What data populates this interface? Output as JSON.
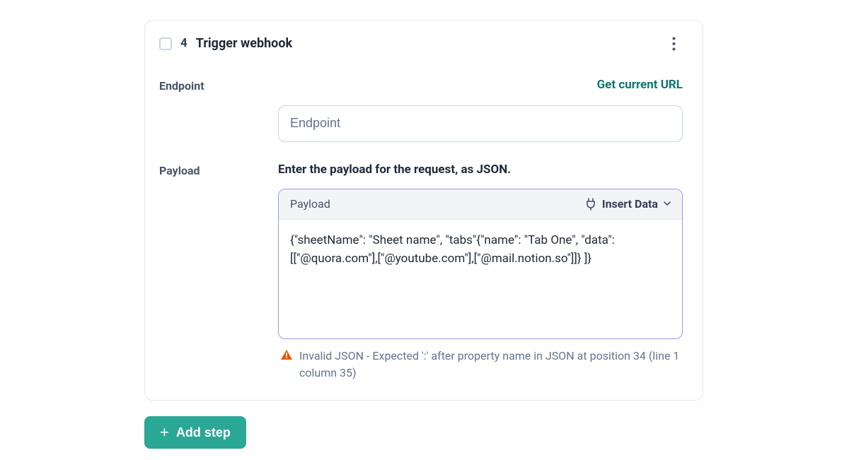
{
  "step": {
    "number": "4",
    "title": "Trigger webhook"
  },
  "endpoint": {
    "label": "Endpoint",
    "link": "Get current URL",
    "placeholder": "Endpoint",
    "value": ""
  },
  "payload": {
    "label": "Payload",
    "helper": "Enter the payload for the request, as JSON.",
    "box_label": "Payload",
    "insert_label": "Insert Data",
    "value": "{\"sheetName\": \"Sheet name\", \"tabs\"{\"name\": \"Tab One\", \"data\": [[\"@quora.com\"],[\"@youtube.com\"],[\"@mail.notion.so\"]]} ]}",
    "error": "Invalid JSON - Expected ':' after property name in JSON at position 34 (line 1 column 35)"
  },
  "add_step": {
    "label": "Add step"
  }
}
